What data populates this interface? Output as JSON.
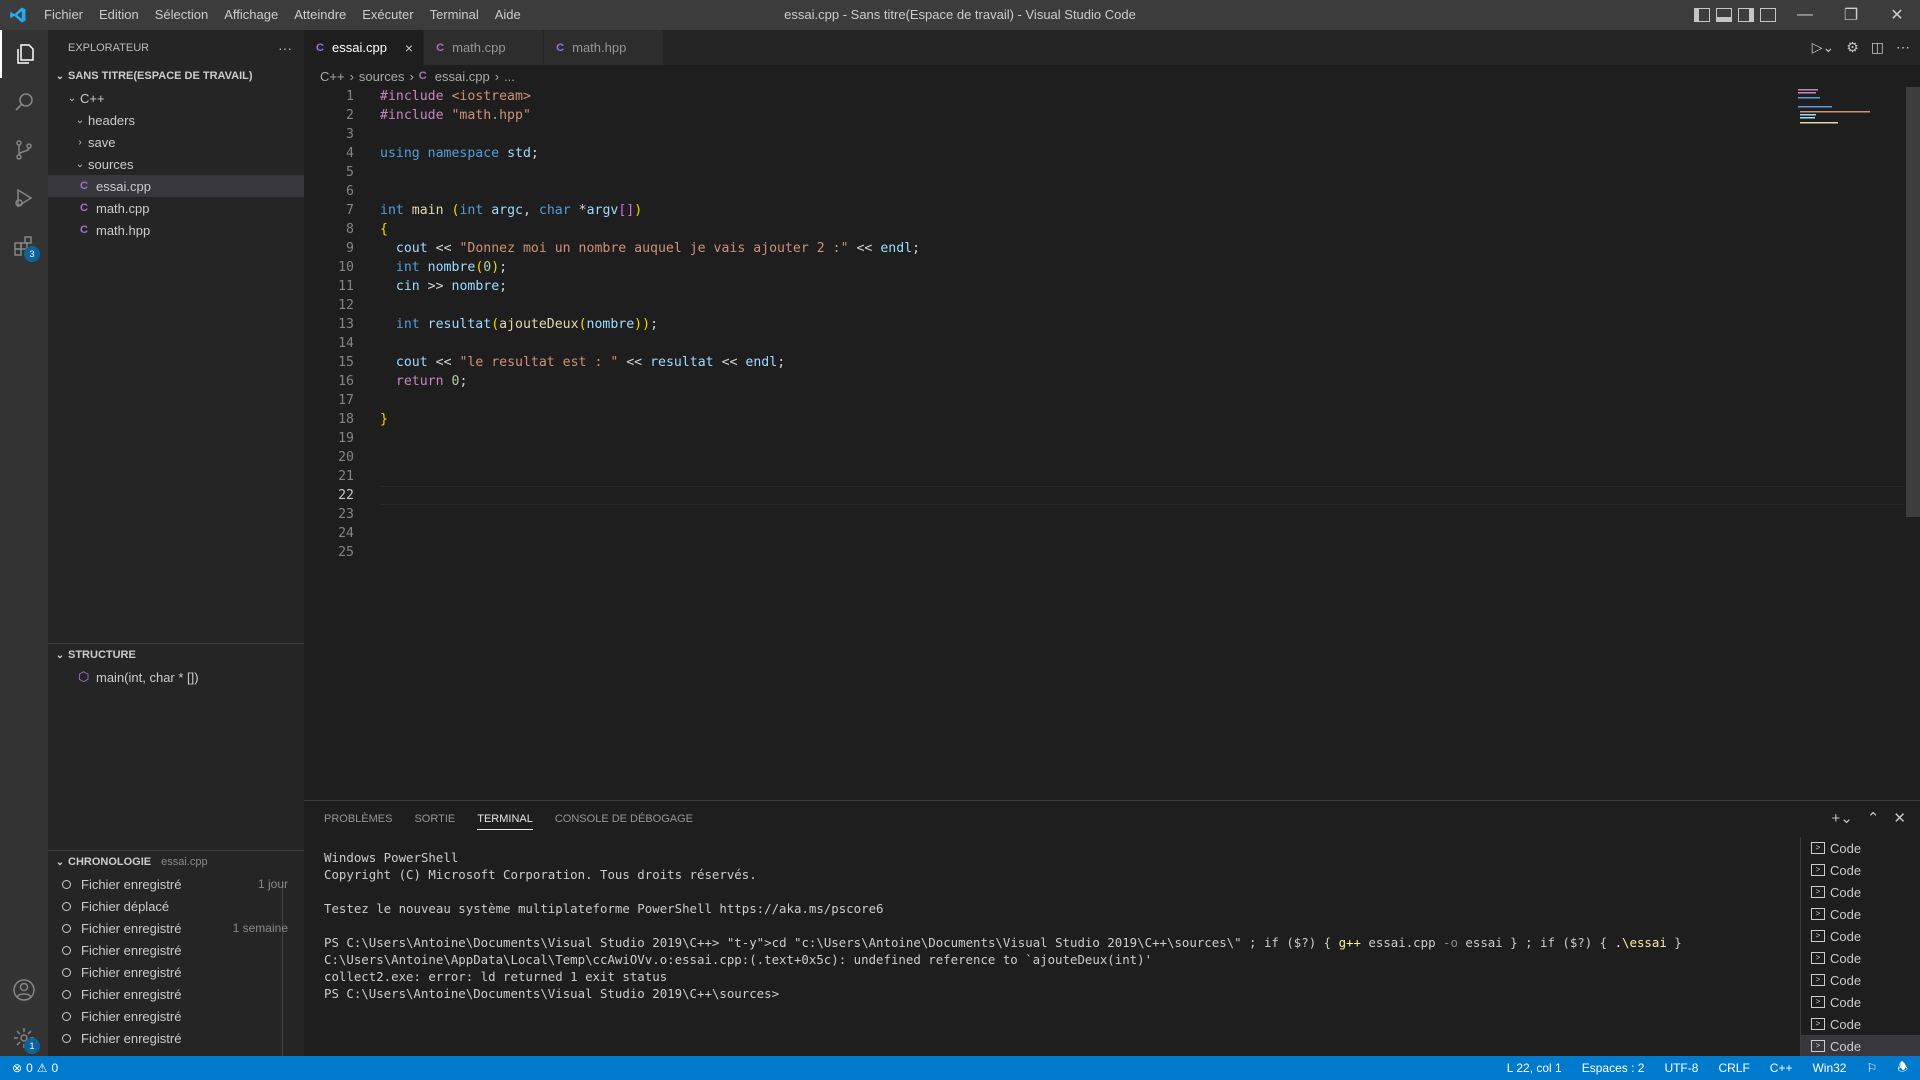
{
  "titlebar": {
    "menu": [
      "Fichier",
      "Edition",
      "Sélection",
      "Affichage",
      "Atteindre",
      "Exécuter",
      "Terminal",
      "Aide"
    ],
    "title": "essai.cpp - Sans titre(Espace de travail) - Visual Studio Code"
  },
  "activitybar": {
    "extensions_badge": "3",
    "settings_badge": "1"
  },
  "sidebar": {
    "header": "EXPLORATEUR",
    "more": "···",
    "workspace": "SANS TITRE(ESPACE DE TRAVAIL)",
    "tree": [
      {
        "label": "C++",
        "type": "folder-open"
      },
      {
        "label": "headers",
        "type": "folder-open"
      },
      {
        "label": "save",
        "type": "folder-closed"
      },
      {
        "label": "sources",
        "type": "folder-open"
      },
      {
        "label": "essai.cpp",
        "type": "file"
      },
      {
        "label": "math.cpp",
        "type": "file"
      },
      {
        "label": "math.hpp",
        "type": "file"
      }
    ],
    "file_icon": "C",
    "structure": {
      "title": "STRUCTURE",
      "items": [
        "main(int, char * [])"
      ]
    },
    "timeline": {
      "title": "CHRONOLOGIE",
      "file": "essai.cpp",
      "items": [
        {
          "label": "Fichier enregistré",
          "when": "1 jour"
        },
        {
          "label": "Fichier déplacé",
          "when": ""
        },
        {
          "label": "Fichier enregistré",
          "when": "1 semaine"
        },
        {
          "label": "Fichier enregistré",
          "when": ""
        },
        {
          "label": "Fichier enregistré",
          "when": ""
        },
        {
          "label": "Fichier enregistré",
          "when": ""
        },
        {
          "label": "Fichier enregistré",
          "when": ""
        },
        {
          "label": "Fichier enregistré",
          "when": ""
        }
      ]
    }
  },
  "editor": {
    "tabs": [
      {
        "label": "essai.cpp",
        "active": true
      },
      {
        "label": "math.cpp",
        "active": false
      },
      {
        "label": "math.hpp",
        "active": false
      }
    ],
    "close": "×",
    "breadcrumb": [
      "C++",
      "sources",
      "essai.cpp",
      "..."
    ],
    "current_line": 22,
    "lines": [
      "#include <iostream>",
      "#include \"math.hpp\"",
      "",
      "using namespace std;",
      "",
      "",
      "int main (int argc, char *argv[])",
      "{",
      "  cout << \"Donnez moi un nombre auquel je vais ajouter 2 :\" << endl;",
      "  int nombre(0);",
      "  cin >> nombre;",
      "",
      "  int resultat(ajouteDeux(nombre));",
      "",
      "  cout << \"le resultat est : \" << resultat << endl;",
      "  return 0;",
      "",
      "}",
      "",
      "",
      "",
      "",
      "",
      "",
      ""
    ]
  },
  "panel": {
    "tabs": [
      {
        "label": "PROBLÈMES",
        "active": false
      },
      {
        "label": "SORTIE",
        "active": false
      },
      {
        "label": "TERMINAL",
        "active": true
      },
      {
        "label": "CONSOLE DE DÉBOGAGE",
        "active": false
      }
    ],
    "terminal": [
      "Windows PowerShell",
      "Copyright (C) Microsoft Corporation. Tous droits réservés.",
      "",
      "Testez le nouveau système multiplateforme PowerShell https://aka.ms/pscore6",
      "",
      "PS C:\\Users\\Antoine\\Documents\\Visual Studio 2019\\C++> cd \"c:\\Users\\Antoine\\Documents\\Visual Studio 2019\\C++\\sources\\\" ; if ($?) { g++ essai.cpp -o essai } ; if ($?) { .\\essai }",
      "C:\\Users\\Antoine\\AppData\\Local\\Temp\\ccAwiOVv.o:essai.cpp:(.text+0x5c): undefined reference to `ajouteDeux(int)'",
      "collect2.exe: error: ld returned 1 exit status",
      "PS C:\\Users\\Antoine\\Documents\\Visual Studio 2019\\C++\\sources>"
    ],
    "terminal_instances": [
      "Code",
      "Code",
      "Code",
      "Code",
      "Code",
      "Code",
      "Code",
      "Code",
      "Code",
      "Code"
    ]
  },
  "statusbar": {
    "errors": "0",
    "warnings": "0",
    "position": "L 22, col 1",
    "spaces": "Espaces : 2",
    "encoding": "UTF-8",
    "eol": "CRLF",
    "language": "C++",
    "platform": "Win32"
  },
  "colors": {
    "accent": "#007acc",
    "titlebar": "#3c3c3c",
    "sidebar": "#252526",
    "editor": "#1e1e1e",
    "file_icon": "#a074c4"
  }
}
